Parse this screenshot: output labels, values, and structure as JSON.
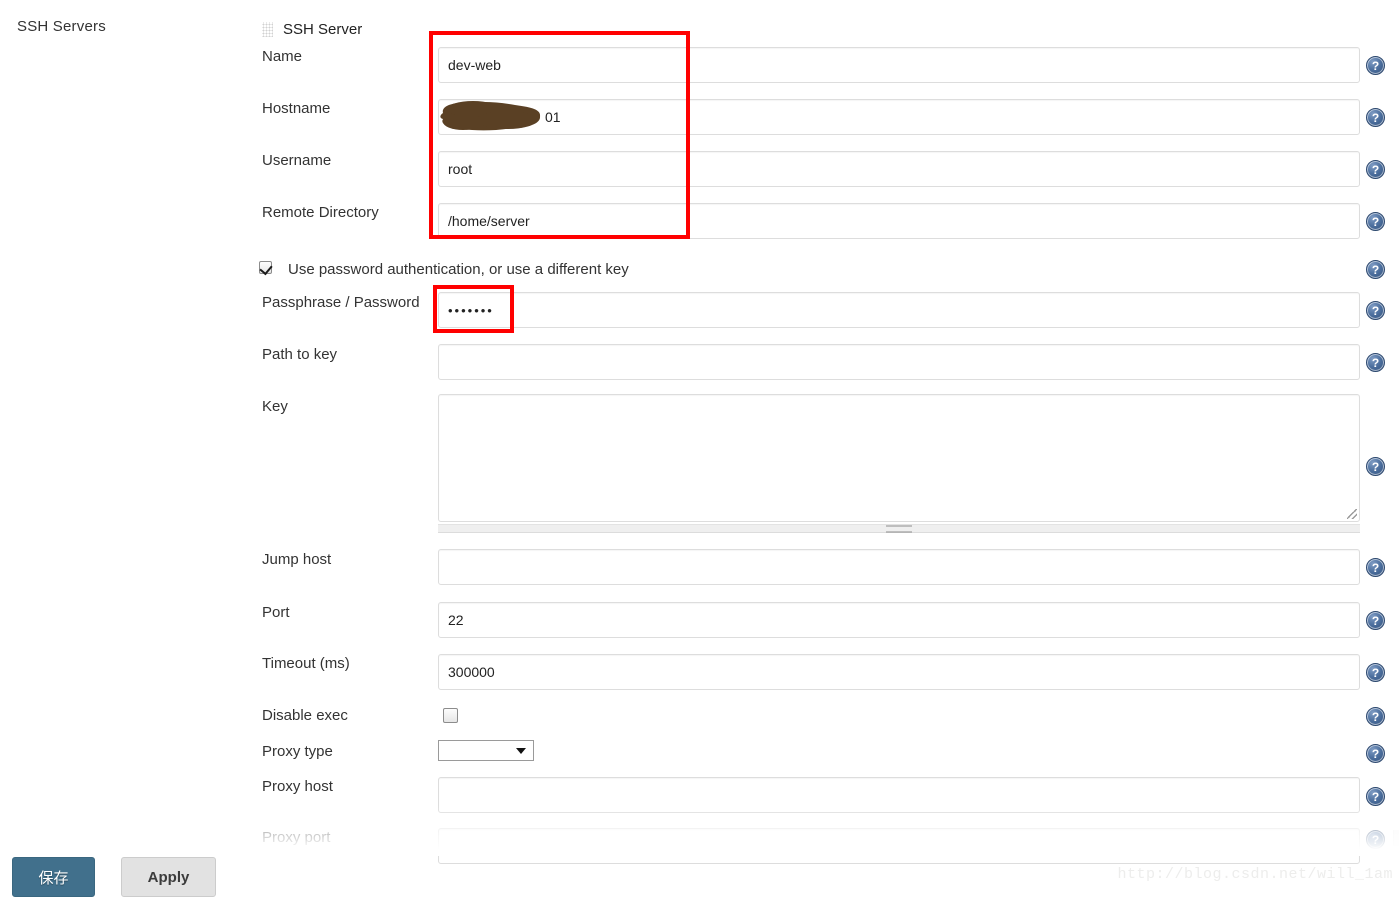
{
  "nav": {
    "title": "SSH Servers"
  },
  "panel": {
    "handle_icon": "drag-handle-icon",
    "header": "SSH Server",
    "help_icon_glyph": "?",
    "fields": [
      {
        "label": "Name",
        "value": "dev-web",
        "type": "text"
      },
      {
        "label": "Hostname",
        "value": "01",
        "type": "text",
        "redacted": true
      },
      {
        "label": "Username",
        "value": "root",
        "type": "text"
      },
      {
        "label": "Remote Directory",
        "value": "/home/server",
        "type": "text"
      },
      {
        "label": "Passphrase / Password",
        "value": "•••••••",
        "type": "password"
      },
      {
        "label": "Path to key",
        "value": "",
        "type": "text"
      },
      {
        "label": "Key",
        "value": "",
        "type": "textarea"
      },
      {
        "label": "Jump host",
        "value": "",
        "type": "text"
      },
      {
        "label": "Port",
        "value": "22",
        "type": "text"
      },
      {
        "label": "Timeout (ms)",
        "value": "300000",
        "type": "text"
      },
      {
        "label": "Disable exec",
        "value": "",
        "type": "checkbox",
        "checked": false
      },
      {
        "label": "Proxy type",
        "value": "",
        "type": "select"
      },
      {
        "label": "Proxy host",
        "value": "",
        "type": "text"
      },
      {
        "label": "Proxy port",
        "value": "",
        "type": "text"
      }
    ],
    "checkbox_row": {
      "label": "Use password authentication, or use a different key",
      "checked": true
    }
  },
  "footer": {
    "save_label": "保存",
    "apply_label": "Apply",
    "watermark": "http://blog.csdn.net/will_1am"
  },
  "colors": {
    "annotation": "#ff0000",
    "save_button": "#41708c",
    "apply_button": "#e2e2e2",
    "help_icon": "#4c6f9e",
    "redaction": "#5a4024"
  }
}
